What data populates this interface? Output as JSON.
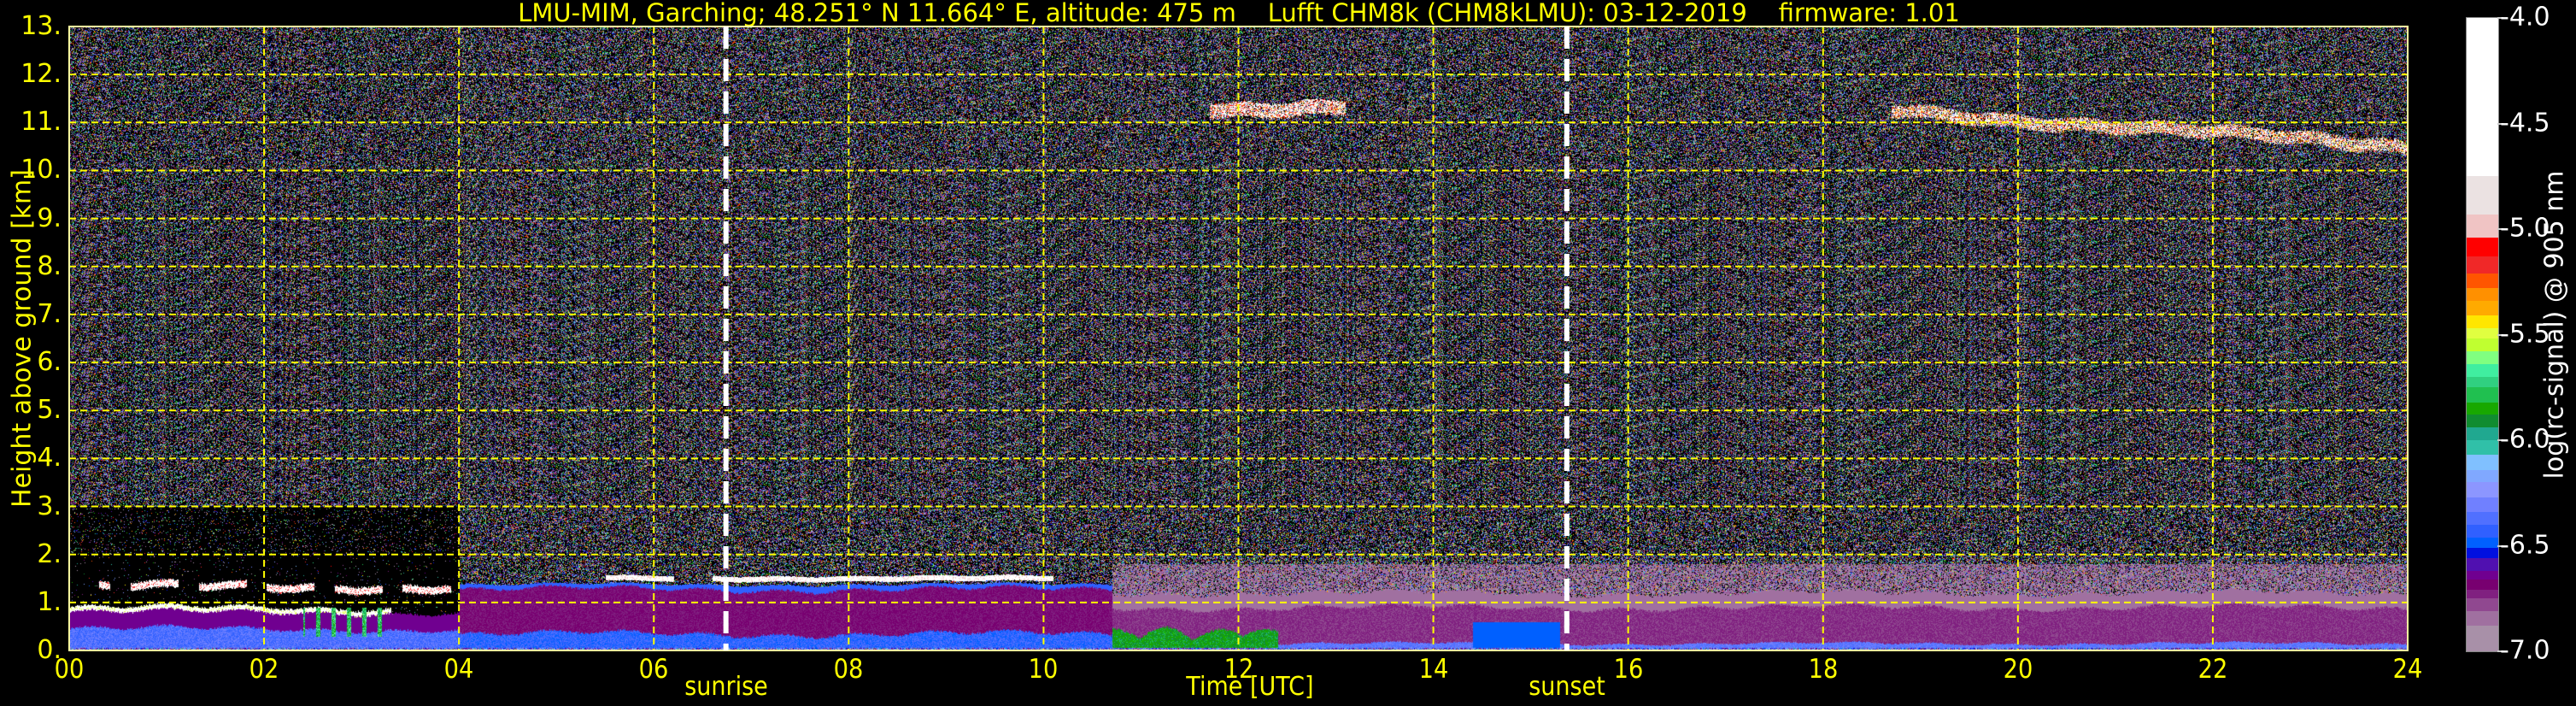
{
  "chart_data": {
    "type": "heatmap",
    "title": "LMU-MIM, Garching; 48.251° N 11.664° E, altitude: 475 m    Lufft CHM8k (CHM8kLMU): 03-12-2019    firmware: 1.01",
    "xlabel": "Time [UTC]",
    "ylabel": "Height above ground [km]",
    "xlim": [
      0,
      24
    ],
    "ylim": [
      0,
      13
    ],
    "grid": true,
    "xticks": [
      0,
      2,
      4,
      6,
      8,
      10,
      12,
      14,
      16,
      18,
      20,
      22,
      24
    ],
    "xtick_labels": [
      "00",
      "02",
      "04",
      "06",
      "08",
      "10",
      "12",
      "14",
      "16",
      "18",
      "20",
      "22",
      "24"
    ],
    "yticks": [
      0,
      1,
      2,
      3,
      4,
      5,
      6,
      7,
      8,
      9,
      10,
      11,
      12,
      13
    ],
    "ytick_labels": [
      "0.",
      "1.",
      "2.",
      "3.",
      "4.",
      "5.",
      "6.",
      "7.",
      "8.",
      "9.",
      "10.",
      "11.",
      "12.",
      "13."
    ],
    "annotations": [
      {
        "text": "sunrise",
        "x": 6.74
      },
      {
        "text": "sunset",
        "x": 15.37
      }
    ],
    "colorbar": {
      "label": "log(rc-signal) @ 905 nm",
      "range": [
        -7.0,
        -4.0
      ],
      "ticks": [
        -4.0,
        -4.5,
        -5.0,
        -5.5,
        -6.0,
        -6.5,
        -7.0
      ],
      "tick_labels": [
        "-4.0",
        "-4.5",
        "-5.0",
        "-5.5",
        "-6.0",
        "-6.5",
        "-7.0"
      ],
      "boundaries": [
        -4.0,
        -4.75,
        -4.93,
        -5.04,
        -5.13,
        -5.21,
        -5.28,
        -5.34,
        -5.41,
        -5.47,
        -5.52,
        -5.58,
        -5.64,
        -5.7,
        -5.75,
        -5.82,
        -5.88,
        -5.94,
        -6.0,
        -6.07,
        -6.14,
        -6.2,
        -6.27,
        -6.34,
        -6.4,
        -6.46,
        -6.51,
        -6.56,
        -6.62,
        -6.66,
        -6.71,
        -6.75,
        -6.81,
        -6.88,
        -7.0
      ],
      "colors": [
        "#ffffff",
        "#ebe2e2",
        "#f0c4c4",
        "#ff0000",
        "#f02828",
        "#ff5500",
        "#ff9000",
        "#ffaa00",
        "#ffe600",
        "#e0ff40",
        "#c0ff30",
        "#80ff80",
        "#40eea0",
        "#30d080",
        "#20c050",
        "#18a800",
        "#108c30",
        "#20a890",
        "#30c0a8",
        "#80c0ff",
        "#80a8ff",
        "#8c96ff",
        "#7080ff",
        "#5070ff",
        "#3060ff",
        "#0060ff",
        "#0010e0",
        "#5010b0",
        "#700090",
        "#780070",
        "#802080",
        "#904890",
        "#a070a0",
        "#a890a8"
      ]
    },
    "features": [
      {
        "name": "boundary-layer-night",
        "t": [
          0,
          4
        ],
        "h": [
          0,
          0.85
        ],
        "value": -6.4
      },
      {
        "name": "low-cloud-night-lower",
        "t": [
          0,
          3.3
        ],
        "h": [
          0.78,
          0.9
        ],
        "value": -4.2
      },
      {
        "name": "low-cloud-night-upper",
        "t": [
          0.3,
          4
        ],
        "h": [
          1.25,
          1.4
        ],
        "value": -4.2
      },
      {
        "name": "aerosol-layer-morning",
        "t": [
          4,
          10.7
        ],
        "h": [
          0,
          1.38
        ],
        "value": -6.68
      },
      {
        "name": "cloud-top-morning",
        "t": [
          5.5,
          10.1
        ],
        "h": [
          1.45,
          1.56
        ],
        "value": -4.2
      },
      {
        "name": "aerosol-layer-afternoon",
        "t": [
          10.7,
          24
        ],
        "h": [
          0,
          1.2
        ],
        "value": -6.75
      },
      {
        "name": "near-ground-green",
        "t": [
          10.7,
          12.4
        ],
        "h": [
          0,
          0.3
        ],
        "value": -5.9
      },
      {
        "name": "near-ground-blue",
        "t": [
          14.4,
          15.3
        ],
        "h": [
          0,
          0.6
        ],
        "value": -6.45
      },
      {
        "name": "cirrus-midday",
        "t": [
          11.7,
          13.1
        ],
        "h": [
          11.15,
          11.45
        ],
        "value": -4.9
      },
      {
        "name": "cirrus-evening",
        "t": [
          18.7,
          24
        ],
        "h_start": 11.25,
        "h_end": 10.5,
        "value": -5.0
      }
    ]
  }
}
